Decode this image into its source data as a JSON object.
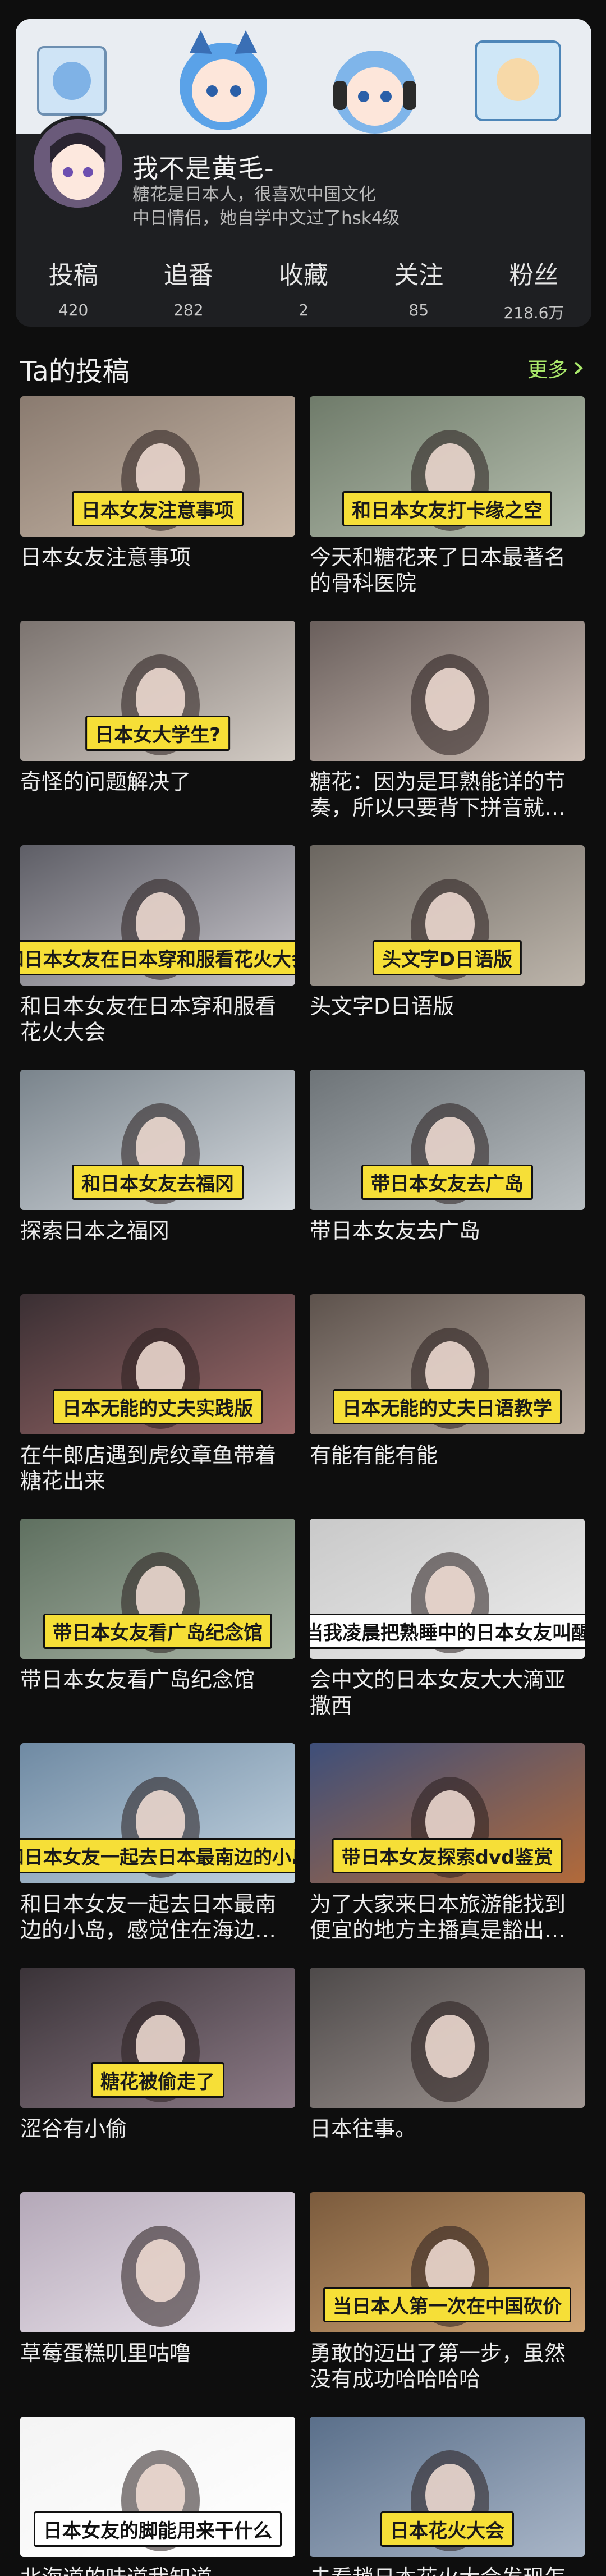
{
  "profile": {
    "name": "我不是黄毛-",
    "bio_lines": [
      "糖花是日本人，很喜欢中国文化",
      "中日情侣，她自学中文过了hsk4级"
    ],
    "stats": [
      {
        "label": "投稿",
        "value": "420"
      },
      {
        "label": "追番",
        "value": "282"
      },
      {
        "label": "收藏",
        "value": "2"
      },
      {
        "label": "关注",
        "value": "85"
      },
      {
        "label": "粉丝",
        "value": "218.6万"
      }
    ]
  },
  "section": {
    "title": "Ta的投稿",
    "more_label": "更多"
  },
  "videos": [
    {
      "title": "日本女友注意事项",
      "caption": "日本女友注意事项",
      "bg": [
        "#8a7b70",
        "#c9b8a8"
      ]
    },
    {
      "title": "今天和糖花来了日本最著名的骨科医院",
      "caption": "和日本女友打卡缘之空",
      "bg": [
        "#6f7b6a",
        "#b7c0b0"
      ]
    },
    {
      "title": "奇怪的问题解决了",
      "caption": "日本女大学生?",
      "bg": [
        "#7c7470",
        "#d2cbc4"
      ]
    },
    {
      "title": "糖花：因为是耳熟能详的节奏，所以只要背下拼音就…",
      "caption": "",
      "bg": [
        "#6a5f5c",
        "#cdbfb6"
      ]
    },
    {
      "title": "和日本女友在日本穿和服看花火大会",
      "caption": "和日本女友在日本穿和服看花火大会",
      "bg": [
        "#5e5e66",
        "#c8c6cc"
      ]
    },
    {
      "title": "头文字D日语版",
      "caption": "头文字D日语版",
      "bg": [
        "#6b6660",
        "#bdb5ab"
      ]
    },
    {
      "title": "探索日本之福冈",
      "caption": "和日本女友去福冈",
      "bg": [
        "#7a848c",
        "#d5dadf"
      ]
    },
    {
      "title": "带日本女友去广岛",
      "caption": "带日本女友去广岛",
      "bg": [
        "#6e7478",
        "#b8bec2"
      ]
    },
    {
      "title": "在牛郎店遇到虎纹章鱼带着糖花出来",
      "caption": "日本无能的丈夫实践版",
      "bg": [
        "#3a2f33",
        "#9d6a6a"
      ]
    },
    {
      "title": "有能有能有能",
      "caption": "日本无能的丈夫日语教学",
      "bg": [
        "#5d524c",
        "#b9aca2"
      ]
    },
    {
      "title": "带日本女友看广岛纪念馆",
      "caption": "带日本女友看广岛纪念馆",
      "bg": [
        "#5f7060",
        "#a9b5a6"
      ]
    },
    {
      "title": "会中文的日本女友大大滴亚撒西",
      "caption": "当我凌晨把熟睡中的日本女友叫醒",
      "bg": [
        "#c9c9c9",
        "#ececec"
      ]
    },
    {
      "title": "和日本女友一起去日本最南边的小岛，感觉住在海边…",
      "caption": "和日本女友一起去日本最南边的小岛",
      "bg": [
        "#6f8aa3",
        "#c2d3e0"
      ]
    },
    {
      "title": "为了大家来日本旅游能找到便宜的地方主播真是豁出…",
      "caption": "带日本女友探索dvd鉴赏",
      "bg": [
        "#3e4f7a",
        "#b26a3a"
      ]
    },
    {
      "title": "涩谷有小偷",
      "caption": "糖花被偷走了",
      "bg": [
        "#3a3338",
        "#8c7a86"
      ]
    },
    {
      "title": "日本往事。",
      "caption": "",
      "bg": [
        "#4e4a4a",
        "#a29894"
      ]
    },
    {
      "title": "草莓蛋糕叽里咕噜",
      "caption": "",
      "bg": [
        "#b4a8b8",
        "#efe8f0"
      ]
    },
    {
      "title": "勇敢的迈出了第一步，虽然没有成功哈哈哈哈",
      "caption": "当日本人第一次在中国砍价",
      "bg": [
        "#7b5b3d",
        "#d0a474"
      ]
    },
    {
      "title": "北海道的味道我知道",
      "caption": "日本女友的脚能用来干什么",
      "bg": [
        "#f4f4f4",
        "#ffffff"
      ]
    },
    {
      "title": "去看趟日本花火大会发现怎么那么多高中生早恋的",
      "caption": "日本花火大会",
      "bg": [
        "#5a6f8a",
        "#a9b6c8"
      ]
    }
  ],
  "colors": {
    "accent": "#a9e86a",
    "caption_yellow": "#f6df37",
    "card_bg": "#1e1f22"
  }
}
